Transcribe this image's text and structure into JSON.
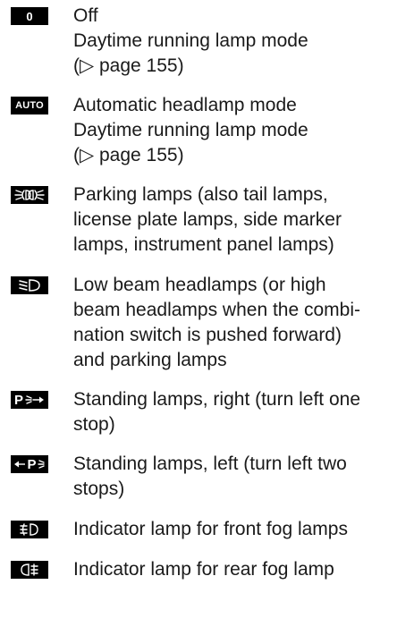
{
  "entries": [
    {
      "symbol": "0",
      "icon": "switch-off-position-icon",
      "lines": [
        "Off",
        "Daytime running lamp mode",
        "(▷ page 155)"
      ]
    },
    {
      "symbol": "AUTO",
      "icon": "auto-headlamp-icon",
      "lines": [
        "Automatic headlamp mode",
        "Daytime running lamp mode",
        "(▷ page 155)"
      ]
    },
    {
      "icon": "parking-lamps-icon",
      "lines": [
        "Parking lamps (also tail lamps,",
        "license plate lamps, side marker",
        "lamps, instrument panel lamps)"
      ]
    },
    {
      "icon": "low-beam-headlamp-icon",
      "lines": [
        "Low beam headlamps (or high",
        "beam headlamps when the combi-",
        "nation switch is pushed forward)",
        "and parking lamps"
      ]
    },
    {
      "symbol": "P",
      "icon": "standing-lamps-right-icon",
      "lines": [
        "Standing lamps, right (turn left one",
        "stop)"
      ]
    },
    {
      "symbol": "P",
      "icon": "standing-lamps-left-icon",
      "lines": [
        "Standing lamps, left (turn left two",
        "stops)"
      ]
    },
    {
      "icon": "front-fog-lamp-indicator-icon",
      "lines": [
        "Indicator lamp for front fog lamps"
      ]
    },
    {
      "icon": "rear-fog-lamp-indicator-icon",
      "lines": [
        "Indicator lamp for rear fog lamp"
      ]
    }
  ]
}
